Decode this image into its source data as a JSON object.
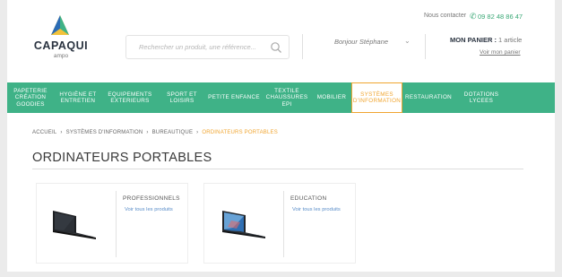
{
  "header": {
    "logo_text": "CAPAQUI",
    "logo_sub": "ampo",
    "contact_label": "Nous contacter",
    "phone": "09 82 48 86 47",
    "search_placeholder": "Rechercher un produit, une référence...",
    "greeting": "Bonjour Stéphane",
    "cart_label": "MON PANIER :",
    "cart_count": "1 article",
    "cart_link": "Voir mon panier"
  },
  "nav": {
    "items": [
      {
        "label": "PAPETERIE CRÉATION GOODIES"
      },
      {
        "label": "HYGIÈNE ET ENTRETIEN"
      },
      {
        "label": "EQUIPEMENTS EXTERIEURS"
      },
      {
        "label": "SPORT ET LOISIRS"
      },
      {
        "label": "PETITE ENFANCE"
      },
      {
        "label": "TEXTILE CHAUSSURES EPI"
      },
      {
        "label": "MOBILIER"
      },
      {
        "label": "SYSTÈMES D'INFORMATION"
      },
      {
        "label": "RESTAURATION"
      },
      {
        "label": "DOTATIONS LYCEES"
      }
    ],
    "active_index": 7
  },
  "breadcrumb": {
    "items": [
      "ACCUEIL",
      "SYSTÈMES D'INFORMATION",
      "BUREAUTIQUE",
      "ORDINATEURS PORTABLES"
    ]
  },
  "page_title": "ORDINATEURS PORTABLES",
  "cards": [
    {
      "title": "PROFESSIONNELS",
      "link": "Voir tous les produits",
      "icon": "laptop-black-icon"
    },
    {
      "title": "EDUCATION",
      "link": "Voir tous les produits",
      "icon": "laptop-blue-icon"
    }
  ],
  "colors": {
    "nav_green": "#3fb287",
    "accent_orange": "#f0a530",
    "link_blue": "#5b8ec9",
    "phone_green": "#3aa876"
  }
}
